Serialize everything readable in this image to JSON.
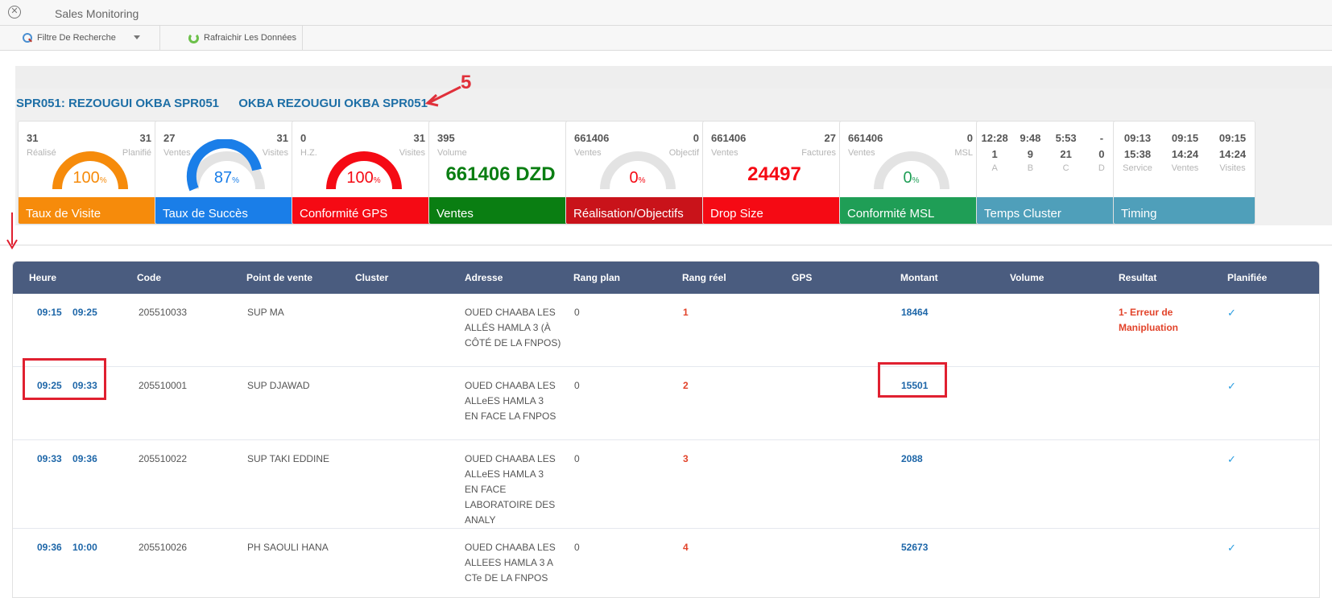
{
  "window": {
    "title": "Sales Monitoring",
    "close_icon": "close-circle-icon"
  },
  "toolbar": {
    "filter_label": "Filtre De Recherche",
    "refresh_label": "Rafraichir Les Données"
  },
  "agent": {
    "code_name": "SPR051: REZOUGUI OKBA SPR051",
    "full_name": "OKBA REZOUGUI OKBA SPR051",
    "annotation": "5"
  },
  "colors": {
    "orange": "#f68b0b",
    "blue": "#1a7ee8",
    "red": "#f50a14",
    "green": "#0a7e12",
    "darkred": "#c9131a",
    "msl_green": "#1f9e56",
    "teal": "#4f9fba",
    "header": "#4a5c7f",
    "link": "#1d66a8"
  },
  "cards": [
    {
      "top_left": "31",
      "top_right": "31",
      "sub_left": "Réalisé",
      "sub_right": "Planifié",
      "value": "100",
      "unit": "%",
      "footer": "Taux de Visite",
      "progress": 1.0
    },
    {
      "top_left": "27",
      "top_right": "31",
      "sub_left": "Ventes",
      "sub_right": "Visites",
      "value": "87",
      "unit": "%",
      "footer": "Taux de Succès",
      "progress": 0.87
    },
    {
      "top_left": "0",
      "top_right": "31",
      "sub_left": "H.Z.",
      "sub_right": "Visites",
      "value": "100",
      "unit": "%",
      "footer": "Conformité GPS",
      "progress": 1.0
    },
    {
      "top_left": "395",
      "sub_left": "Volume",
      "big": "661406 DZD",
      "footer": "Ventes"
    },
    {
      "top_left": "661406",
      "top_right": "0",
      "sub_left": "Ventes",
      "sub_right": "Objectif",
      "value": "0",
      "unit": "%",
      "footer": "Réalisation/Objectifs",
      "progress": 0.0
    },
    {
      "top_left": "661406",
      "top_right": "27",
      "sub_left": "Ventes",
      "sub_right": "Factures",
      "big": "24497",
      "footer": "Drop Size"
    },
    {
      "top_left": "661406",
      "top_right": "0",
      "sub_left": "Ventes",
      "sub_right": "MSL",
      "value": "0",
      "unit": "%",
      "footer": "Conformité MSL",
      "progress": 0.0
    },
    {
      "row1": [
        "12:28",
        "9:48",
        "5:53",
        "-"
      ],
      "row2": [
        "1",
        "9",
        "21",
        "0"
      ],
      "labels": [
        "A",
        "B",
        "C",
        "D"
      ],
      "footer": "Temps Cluster"
    },
    {
      "row1": [
        "09:13",
        "09:15",
        "09:15"
      ],
      "row2": [
        "15:38",
        "14:24",
        "14:24"
      ],
      "labels": [
        "Service",
        "Ventes",
        "Visites"
      ],
      "footer": "Timing"
    }
  ],
  "table": {
    "headers": [
      "Heure",
      "Code",
      "Point de vente",
      "Cluster",
      "Adresse",
      "Rang plan",
      "Rang réel",
      "GPS",
      "Montant",
      "Volume",
      "Resultat",
      "Planifiée"
    ],
    "rows": [
      {
        "start": "09:15",
        "end": "09:25",
        "code": "205510033",
        "pdv": "SUP MA",
        "adresse": [
          "OUED CHAABA LES",
          "ALLÉS HAMLA 3 (À",
          "CÔTÉ DE LA FNPOS)"
        ],
        "rang_plan": "0",
        "rang_reel": "1",
        "montant": "18464",
        "resultat": [
          "1- Erreur de",
          "Manipluation"
        ],
        "planifiee": "✓"
      },
      {
        "start": "09:25",
        "end": "09:33",
        "code": "205510001",
        "pdv": "SUP DJAWAD",
        "adresse": [
          "OUED CHAABA LES",
          "ALLeES HAMLA 3",
          "EN FACE LA FNPOS"
        ],
        "rang_plan": "0",
        "rang_reel": "2",
        "montant": "15501",
        "resultat": [
          "",
          ""
        ],
        "planifiee": "✓"
      },
      {
        "start": "09:33",
        "end": "09:36",
        "code": "205510022",
        "pdv": "SUP TAKI EDDINE",
        "adresse": [
          "OUED CHAABA LES",
          "ALLeES HAMLA 3",
          "EN FACE",
          "LABORATOIRE DES",
          "ANALY"
        ],
        "rang_plan": "0",
        "rang_reel": "3",
        "montant": "2088",
        "resultat": [
          "",
          ""
        ],
        "planifiee": "✓"
      },
      {
        "start": "09:36",
        "end": "10:00",
        "code": "205510026",
        "pdv": "PH SAOULI HANA",
        "adresse": [
          "OUED CHAABA LES",
          "ALLEES HAMLA 3 A",
          "CTe DE LA FNPOS"
        ],
        "rang_plan": "0",
        "rang_reel": "4",
        "montant": "52673",
        "resultat": [
          "",
          ""
        ],
        "planifiee": "✓"
      }
    ]
  }
}
